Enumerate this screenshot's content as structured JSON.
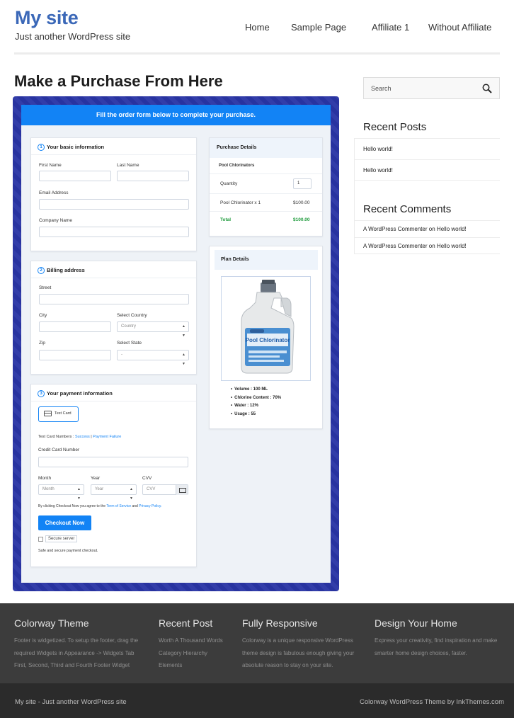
{
  "header": {
    "site_title": "My site",
    "tagline": "Just another WordPress site",
    "nav": [
      "Home",
      "Sample Page",
      "Affiliate 1",
      "Without Affiliate"
    ]
  },
  "main": {
    "page_title": "Make a Purchase From Here",
    "form": {
      "banner": "Fill the order form below to complete your purchase.",
      "basic": {
        "num": "1",
        "title": "Your basic information",
        "first_name": "First Name",
        "last_name": "Last Name",
        "email": "Email Address",
        "company": "Company Name"
      },
      "billing": {
        "num": "2",
        "title": "Billing address",
        "street": "Street",
        "city": "City",
        "select_country": "Select Country",
        "country_value": "Country",
        "zip": "Zip",
        "select_state": "Select State",
        "state_value": "-"
      },
      "payment": {
        "num": "3",
        "title": "Your payment information",
        "test_card": "Test Card",
        "test_numbers_label": "Test Card Numbers :",
        "success": "Success",
        "sep": "|",
        "failure": "Payment Failure",
        "credit_card_number": "Credit Card Number",
        "month": "Month",
        "month_value": "Month",
        "year": "Year",
        "year_value": "Year",
        "cvv": "CVV",
        "cvv_value": "CVV",
        "agree_prefix": "By clicking Checkout Now you agree to the",
        "terms": "Term of Service",
        "and": "and",
        "privacy": "Privacy Policy.",
        "checkout": "Checkout Now",
        "secure_server": "Secure server",
        "secure_note": "Safe and secure payment checkout."
      },
      "purchase": {
        "title": "Purchase Details",
        "product": "Pool Chlorinators",
        "quantity_label": "Quantity",
        "quantity_value": "1",
        "line_item": "Pool Chlorinator x 1",
        "line_price": "$100.00",
        "total_label": "Total",
        "total_value": "$100.00"
      },
      "plan": {
        "title": "Plan Details",
        "label_text": "Pool Chlorinator",
        "features": [
          "Volume : 100 ML",
          "Chlorine Content : 70%",
          "Water : 12%",
          "Usage : 55"
        ]
      }
    }
  },
  "sidebar": {
    "search_placeholder": "Search",
    "recent_posts_title": "Recent Posts",
    "recent_posts": [
      "Hello world!",
      "Hello world!"
    ],
    "recent_comments_title": "Recent Comments",
    "recent_comments": [
      {
        "author": "A WordPress Commenter",
        "on": "on",
        "post": "Hello world!"
      },
      {
        "author": "A WordPress Commenter",
        "on": "on",
        "post": "Hello world!"
      }
    ]
  },
  "footer": {
    "columns": [
      {
        "title": "Colorway Theme",
        "lines": [
          "Footer is widgetized. To setup the footer, drag the",
          "required Widgets in Appearance -> Widgets Tab",
          "First, Second, Third and Fourth Footer Widget"
        ]
      },
      {
        "title": "Recent Post",
        "lines": [
          "Worth A Thousand Words",
          "Category Hierarchy",
          "Elements"
        ]
      },
      {
        "title": "Fully Responsive",
        "lines": [
          "Colorway is a unique responsive WordPress",
          "theme design is fabulous enough giving your",
          "absolute reason to stay on your site."
        ]
      },
      {
        "title": "Design Your Home",
        "lines": [
          "Express your creativity, find inspiration and make",
          "smarter home design choices, faster."
        ]
      }
    ],
    "bottom_left": "My site - Just another WordPress site",
    "bottom_right": "Colorway WordPress Theme by InkThemes.com"
  },
  "colors": {
    "site_title": "#3b68b8",
    "frame": "#2a35a6",
    "accent_blue": "#1283f5",
    "total_green": "#1e9b3c",
    "footer_bg": "#3c3c3c",
    "bottom_bar_bg": "#2b2b2b"
  },
  "icons": {
    "search": "search-icon",
    "card": "credit-card-icon",
    "cvv": "cvv-card-icon",
    "dropdown": "dropdown-caret-icon"
  }
}
